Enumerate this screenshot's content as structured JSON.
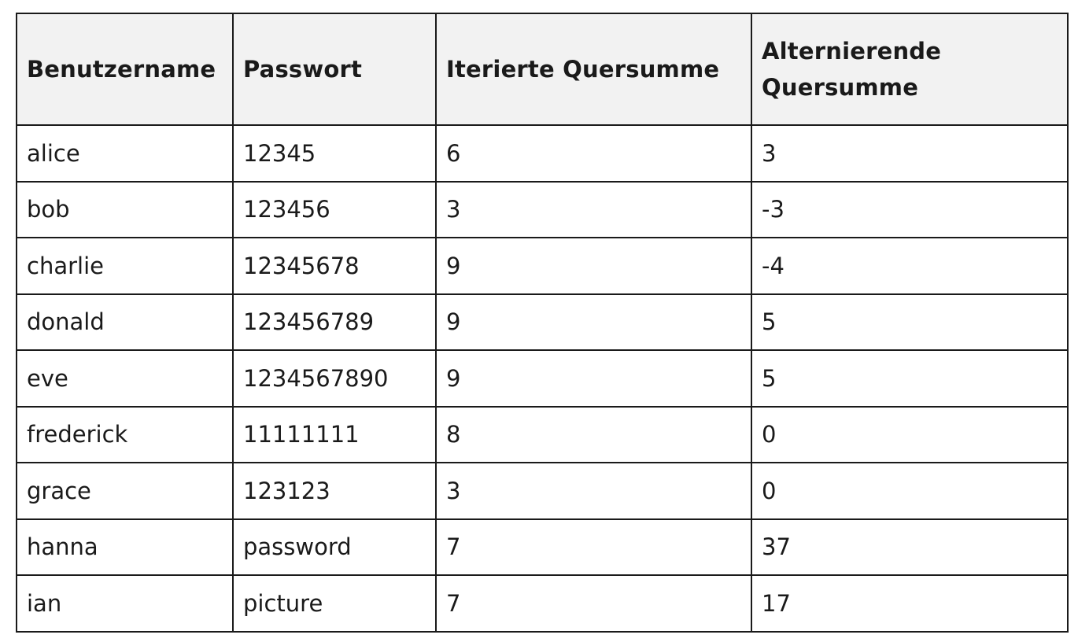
{
  "table": {
    "headers": [
      "Benutzername",
      "Passwort",
      "Iterierte Quersumme",
      "Alternierende Quersumme"
    ],
    "rows": [
      [
        "alice",
        "12345",
        "6",
        "3"
      ],
      [
        "bob",
        "123456",
        "3",
        "-3"
      ],
      [
        "charlie",
        "12345678",
        "9",
        "-4"
      ],
      [
        "donald",
        "123456789",
        "9",
        "5"
      ],
      [
        "eve",
        "1234567890",
        "9",
        "5"
      ],
      [
        "frederick",
        "11111111",
        "8",
        "0"
      ],
      [
        "grace",
        "123123",
        "3",
        "0"
      ],
      [
        "hanna",
        "password",
        "7",
        "37"
      ],
      [
        "ian",
        "picture",
        "7",
        "17"
      ]
    ]
  }
}
